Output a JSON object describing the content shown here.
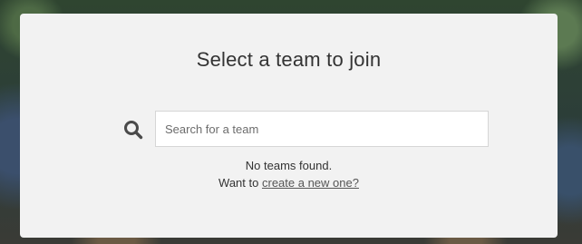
{
  "dialog": {
    "title": "Select a team to join"
  },
  "search": {
    "icon": "search-icon",
    "placeholder": "Search for a team",
    "value": ""
  },
  "results": {
    "empty_message": "No teams found.",
    "create_prompt": "Want to",
    "create_link": "create a new one?"
  }
}
